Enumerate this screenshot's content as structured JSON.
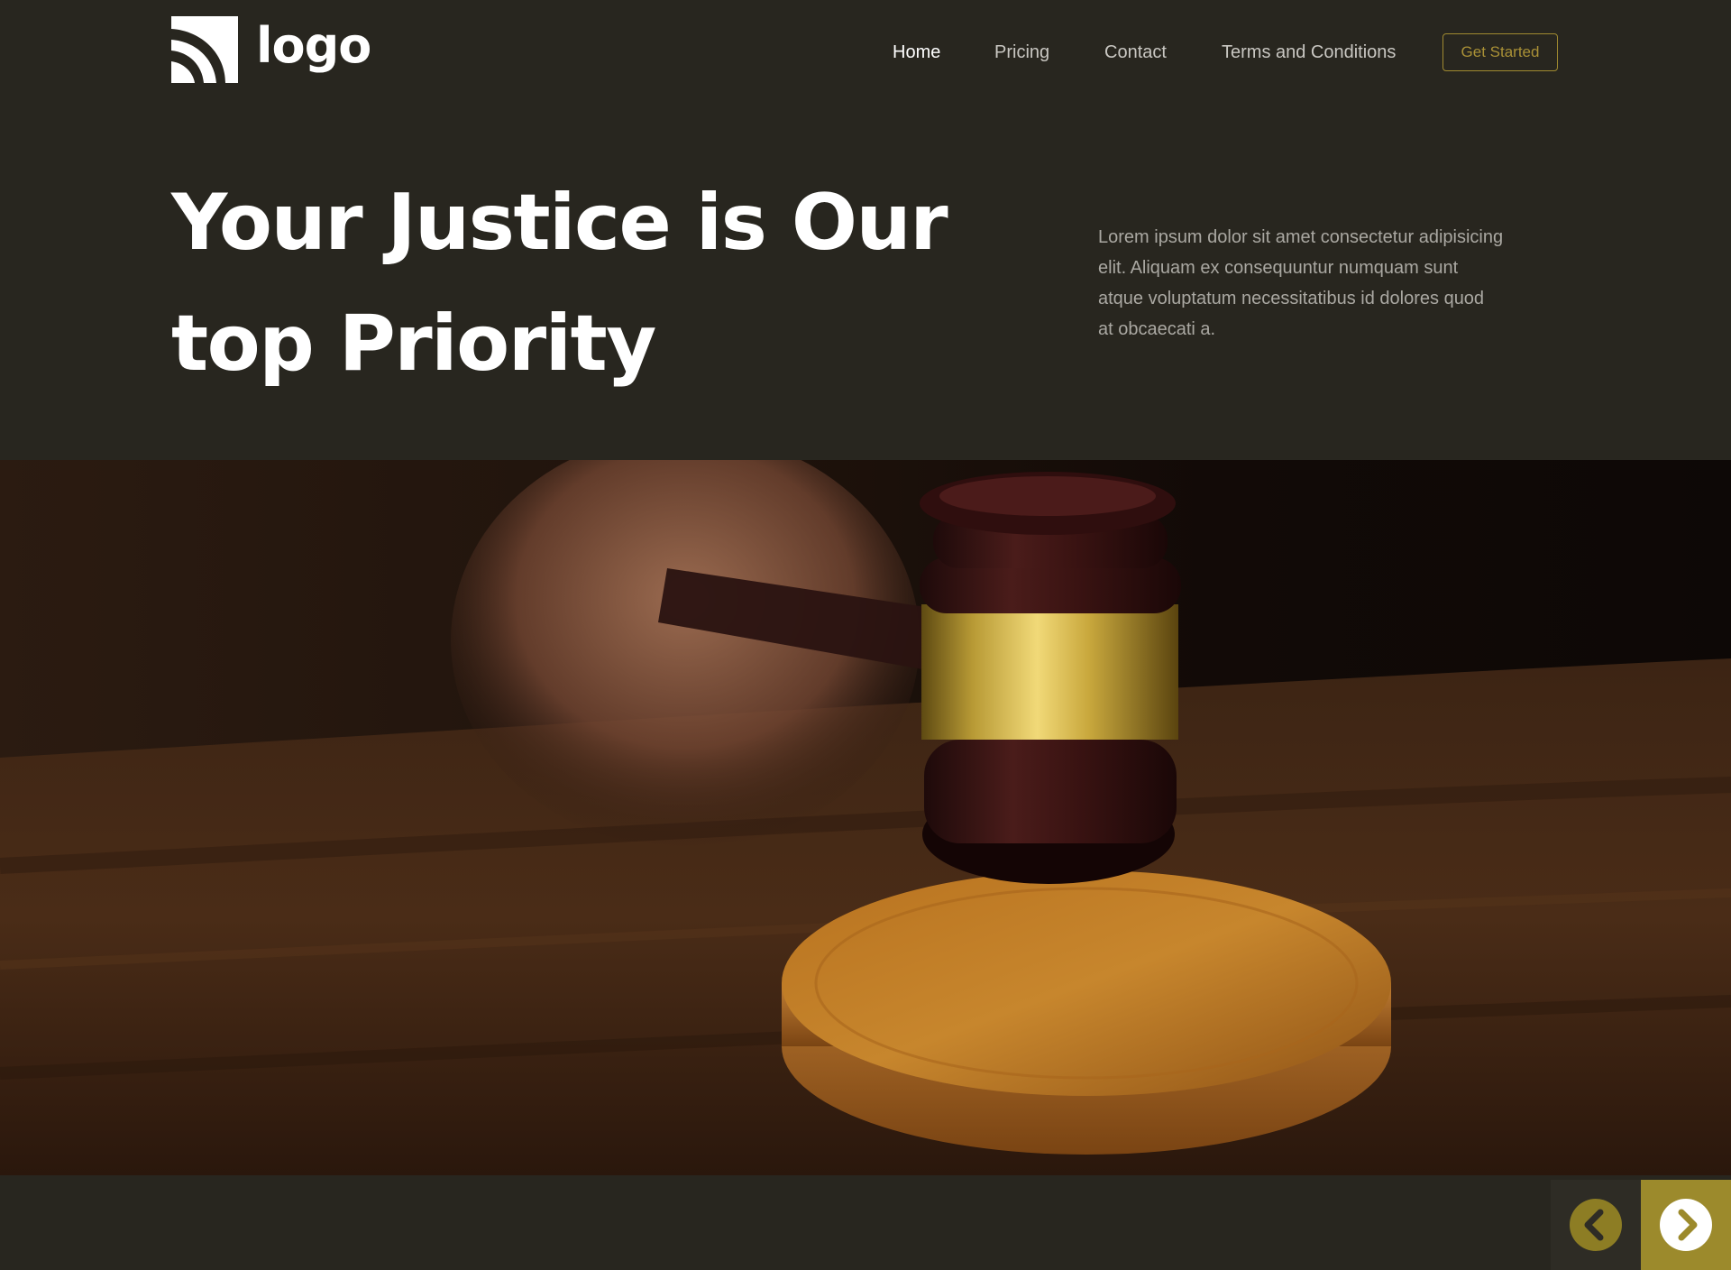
{
  "header": {
    "logo_text": "logo",
    "nav": {
      "home": "Home",
      "pricing": "Pricing",
      "contact": "Contact",
      "terms": "Terms and Conditions"
    },
    "cta_label": "Get Started"
  },
  "hero": {
    "title_line1": "Your Justice is Our",
    "title_line2": "top Priority",
    "description": "Lorem ipsum dolor sit amet consectetur adipisicing elit. Aliquam ex consequuntur numquam sunt atque voluptatum necessitatibus id dolores quod at obcaecati a."
  },
  "image": {
    "subject": "gavel-on-sound-block"
  },
  "slider": {
    "prev_icon": "chevron-left-icon",
    "next_icon": "chevron-right-icon"
  },
  "colors": {
    "background": "#28261f",
    "accent": "#9c8a2c",
    "text_primary": "#ffffff",
    "text_muted": "#aaa8a2"
  }
}
